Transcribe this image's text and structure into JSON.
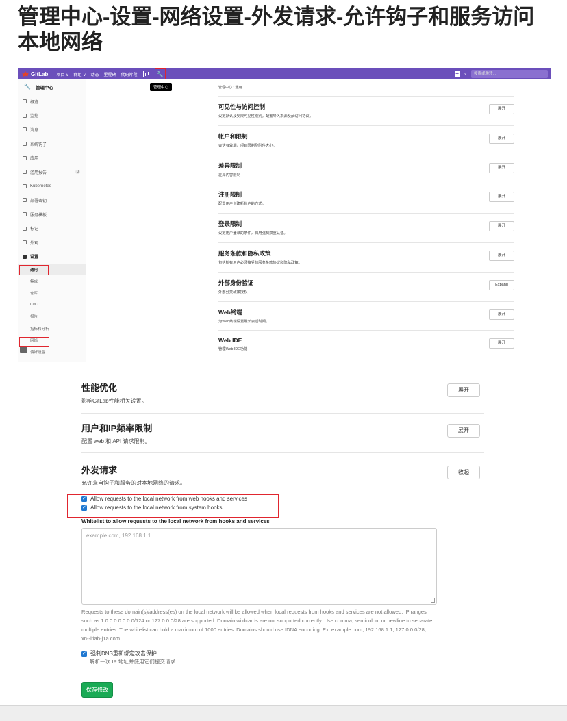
{
  "article": {
    "title": "管理中心-设置-网络设置-外发请求-允许钩子和服务访问本地网络"
  },
  "topbar": {
    "brand": "GitLab",
    "nav": [
      "项目 ∨",
      "群组 ∨",
      "动态",
      "里程碑",
      "代码片段"
    ],
    "tooltip": "管理中心",
    "search_placeholder": "搜索或跳转...",
    "colors": {
      "bar": "#6b4fbb",
      "highlight": "#e0262f"
    }
  },
  "sidebar": {
    "header": "管理中心",
    "items": [
      {
        "label": "概览",
        "icon": "grid-icon"
      },
      {
        "label": "监控",
        "icon": "monitor-icon"
      },
      {
        "label": "消息",
        "icon": "broadcast-icon"
      },
      {
        "label": "系统钩子",
        "icon": "hook-icon"
      },
      {
        "label": "应用",
        "icon": "apps-icon"
      },
      {
        "label": "滥用报告",
        "icon": "report-icon",
        "count": "0"
      },
      {
        "label": "Kubernetes",
        "icon": "kubernetes-icon"
      },
      {
        "label": "部署密钥",
        "icon": "key-icon"
      },
      {
        "label": "服务模板",
        "icon": "template-icon"
      },
      {
        "label": "标记",
        "icon": "label-icon"
      },
      {
        "label": "外观",
        "icon": "appearance-icon"
      },
      {
        "label": "设置",
        "icon": "settings-icon"
      }
    ],
    "subitems": [
      "通用",
      "集成",
      "仓库",
      "CI/CD",
      "报告",
      "指标和分析",
      "网络",
      "偏好设置"
    ]
  },
  "general": {
    "breadcrumb": "管理中心 › 通用",
    "sections": [
      {
        "title": "可见性与访问控制",
        "desc": "设定默认及受限可见性级别。配置导入来源及git访问协议。",
        "button": "展开"
      },
      {
        "title": "帐户和限制",
        "desc": "会话有效期，项目限制及附件大小。",
        "button": "展开"
      },
      {
        "title": "差异限制",
        "desc": "差异内容限制",
        "button": "展开"
      },
      {
        "title": "注册限制",
        "desc": "配置用户创建新帐户的方式。",
        "button": "展开"
      },
      {
        "title": "登录限制",
        "desc": "设定用户登录的条件，启用强制双重认证。",
        "button": "展开"
      },
      {
        "title": "服务条款和隐私政策",
        "desc": "包括所有用户必须接受的服务条款协议和隐私政策。",
        "button": "展开"
      },
      {
        "title": "外部身份验证",
        "desc": "外部分类政策授权",
        "button": "Expand"
      },
      {
        "title": "Web终端",
        "desc": "为Web终端设置最长会话时间。",
        "button": "展开"
      },
      {
        "title": "Web IDE",
        "desc": "管理Web IDE功能",
        "button": "展开"
      }
    ]
  },
  "network": {
    "performance": {
      "title": "性能优化",
      "desc": "影响GitLab性能相关设置。",
      "button": "展开"
    },
    "rate_limits": {
      "title": "用户和IP频率限制",
      "desc": "配置 web 和 API 请求限制。",
      "button": "展开"
    },
    "outbound": {
      "title": "外发请求",
      "desc": "允许来自钩子和服务的对本地网络的请求。",
      "button": "收起",
      "checkbox_webhooks": "Allow requests to the local network from web hooks and services",
      "checkbox_system_hooks": "Allow requests to the local network from system hooks",
      "whitelist_label": "Whitelist to allow requests to the local network from hooks and services",
      "whitelist_placeholder": "example.com, 192.168.1.1",
      "help_text": "Requests to these domain(s)/address(es) on the local network will be allowed when local requests from hooks and services are not allowed. IP ranges such as 1:0:0:0:0:0:0:0/124 or 127.0.0.0/28 are supported. Domain wildcards are not supported currently. Use comma, semicolon, or newline to separate multiple entries. The whitelist can hold a maximum of 1000 entries. Domains should use IDNA encoding. Ex: example.com, 192.168.1.1, 127.0.0.0/28, xn--itlab-j1a.com.",
      "dns_checkbox": "强制DNS重新绑定攻击保护",
      "dns_help": "解析一次 IP 地址并使用它们提交请求",
      "save_button": "保存修改"
    }
  }
}
